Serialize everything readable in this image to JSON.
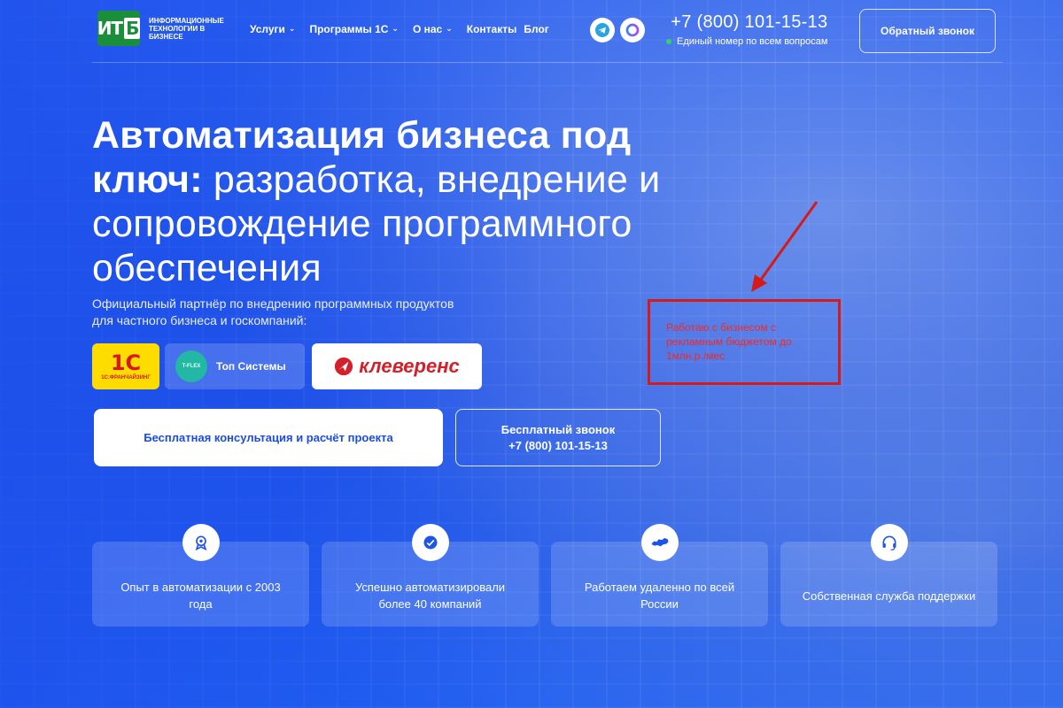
{
  "header": {
    "logo": {
      "mark": "ИТ",
      "mark_accent": "Б",
      "text": "ИНФОРМАЦИОННЫЕ ТЕХНОЛОГИИ в БИЗНЕСЕ"
    },
    "nav": [
      {
        "label": "Услуги",
        "has_dropdown": true
      },
      {
        "label": "Программы 1С",
        "has_dropdown": true
      },
      {
        "label": "О нас",
        "has_dropdown": true
      },
      {
        "label": "Контакты",
        "has_dropdown": false
      },
      {
        "label": "Блог",
        "has_dropdown": false
      }
    ],
    "phone": "+7 (800) 101-15-13",
    "phone_caption": "Единый номер по всем вопросам",
    "callback_label": "Обратный звонок",
    "social": [
      "telegram-icon",
      "max-messenger-icon"
    ]
  },
  "hero": {
    "title_bold": "Автоматизация бизнеса под ключ:",
    "title_rest": " разработка, внедрение и сопровождение программного обеспечения",
    "subtitle": "Официальный партнёр по внедрению программных продуктов для частного бизнеса и госкомпаний:",
    "partners": {
      "onec": {
        "logo": "1С",
        "caption": "1С:ФРАНЧАЙЗИНГ"
      },
      "topsys": {
        "badge": "T-FLEX",
        "label": "Топ Системы"
      },
      "kleverens": {
        "label": "клеверенс"
      }
    },
    "cta_primary": "Бесплатная консультация и расчёт проекта",
    "cta_secondary_line1": "Бесплатный звонок",
    "cta_secondary_line2": "+7 (800) 101-15-13"
  },
  "annotation": {
    "text": "Работаю с бизнесом с рекламным бюджетом до 1млн.р./мес",
    "color": "#d51a1a"
  },
  "features": [
    {
      "icon": "medal-icon",
      "text": "Опыт в автоматизации с 2003 года"
    },
    {
      "icon": "check-badge-icon",
      "text": "Успешно автоматизировали более 40 компаний"
    },
    {
      "icon": "russia-map-icon",
      "text": "Работаем удаленно по всей России"
    },
    {
      "icon": "headset-icon",
      "text": "Собственная служба поддержки"
    }
  ],
  "colors": {
    "brand_blue": "#1f55e6",
    "logo_green": "#1b8e3b",
    "accent_red": "#d51a1a"
  }
}
